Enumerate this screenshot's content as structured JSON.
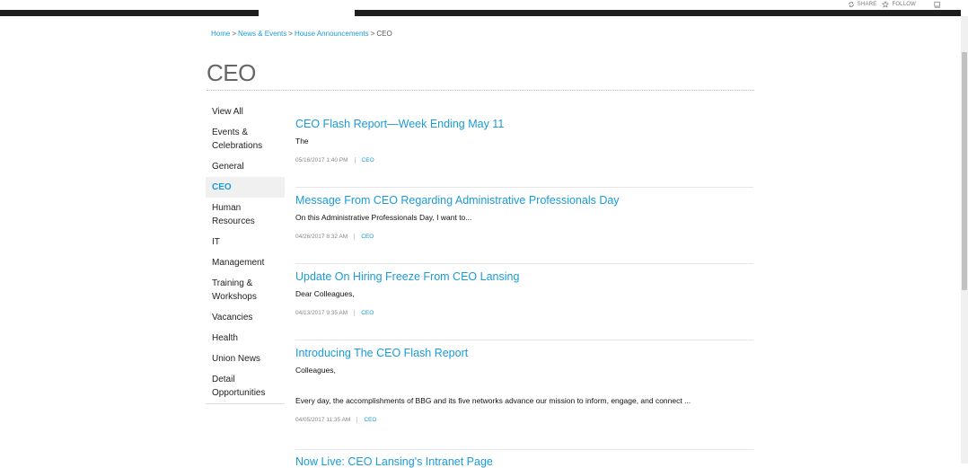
{
  "topbar": {
    "share_label": "SHARE",
    "follow_label": "FOLLOW"
  },
  "breadcrumb": {
    "items": [
      "Home",
      "News & Events",
      "House Announcements"
    ],
    "current": "CEO",
    "separator": ">"
  },
  "page": {
    "title": "CEO"
  },
  "leftnav": {
    "items": [
      {
        "label": "View All"
      },
      {
        "label": "Events & Celebrations"
      },
      {
        "label": "General"
      },
      {
        "label": "CEO"
      },
      {
        "label": "Human Resources"
      },
      {
        "label": "IT"
      },
      {
        "label": "Management"
      },
      {
        "label": "Training & Workshops"
      },
      {
        "label": "Vacancies"
      },
      {
        "label": "Health"
      },
      {
        "label": "Union News"
      },
      {
        "label": "Detail Opportunities"
      }
    ],
    "active_index": 3
  },
  "posts": [
    {
      "title": "CEO Flash Report—Week Ending May 11",
      "excerpt": "The",
      "date": "05/16/2017 1:40 PM",
      "category": "CEO"
    },
    {
      "title": "Message From CEO Regarding Administrative Professionals Day",
      "excerpt": "On this Administrative Professionals Day, I want to...",
      "date": "04/26/2017 8:32 AM",
      "category": "CEO"
    },
    {
      "title": "Update On Hiring Freeze From CEO Lansing",
      "excerpt": "Dear Colleagues,",
      "date": "04/13/2017 9:35 AM",
      "category": "CEO"
    },
    {
      "title": "Introducing The CEO Flash Report",
      "excerpt": "Colleagues,",
      "excerpt2": "Every day, the accomplishments of BBG and its five networks advance our mission to inform, engage, and connect ...",
      "date": "04/05/2017 11:35 AM",
      "category": "CEO"
    },
    {
      "title": "Now Live: CEO Lansing's Intranet Page"
    }
  ],
  "colors": {
    "link": "#1a9bd7",
    "topbar": "#1e1e1e",
    "active_bg": "#f0f0f0"
  }
}
